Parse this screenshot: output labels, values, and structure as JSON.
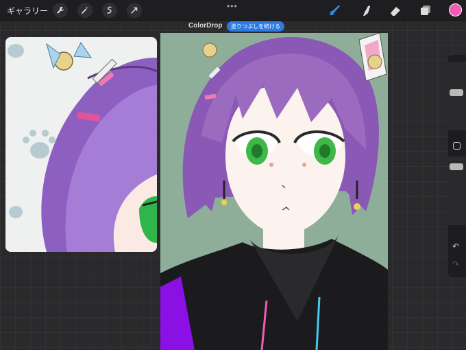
{
  "topbar": {
    "gallery_label": "ギャラリー",
    "tools_left": [
      "wrench-icon",
      "magic-wand-icon",
      "selection-icon",
      "transform-arrow-icon"
    ],
    "tools_right": [
      "brush-icon",
      "smudge-icon",
      "eraser-icon",
      "layers-icon"
    ],
    "menu_dots": "•••",
    "active_color": "#f05cb8"
  },
  "banner": {
    "title": "ColorDrop",
    "button_label": "塗りつぶしを続ける"
  },
  "reference_window": {
    "content": "zoomed reference of character hair and eye"
  },
  "sidebar": {
    "undo_glyph": "↶",
    "redo_glyph": "↷"
  },
  "colors": {
    "canvas_bg": "#8fae9a",
    "hair": "#9b6bbf",
    "hoodie": "#1b1b1d",
    "sleeve": "#8a10e6",
    "eyes": "#3fb84a",
    "accent_pink": "#f05cb8"
  }
}
